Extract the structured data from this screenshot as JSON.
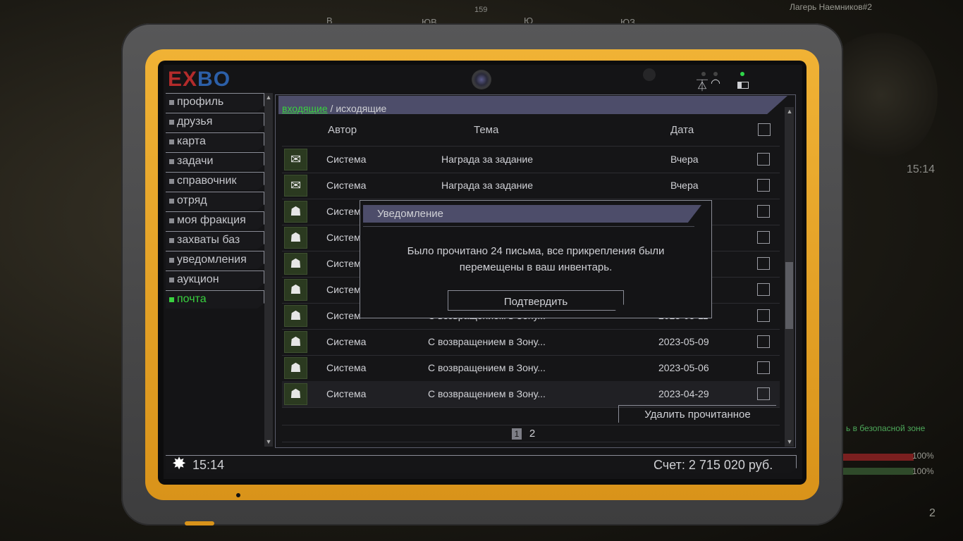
{
  "hud": {
    "compass": [
      "В",
      "ЮВ",
      "159",
      "Ю",
      "ЮЗ"
    ],
    "location": "Лагерь Наемников#2",
    "time": "15:14",
    "safe_zone_text": "ь в безопасной зоне",
    "health_pct": "100%",
    "stamina_pct": "100%",
    "ammo": "2"
  },
  "tablet": {
    "logo": {
      "part1": "EX",
      "part2": "BO"
    },
    "led_color": "#2fd64a"
  },
  "menu": {
    "items": [
      {
        "label": "профиль"
      },
      {
        "label": "друзья"
      },
      {
        "label": "карта"
      },
      {
        "label": "задачи"
      },
      {
        "label": "справочник"
      },
      {
        "label": "отряд"
      },
      {
        "label": "моя фракция"
      },
      {
        "label": "захваты баз"
      },
      {
        "label": "уведомления"
      },
      {
        "label": "аукцион"
      },
      {
        "label": "почта",
        "active": true
      }
    ]
  },
  "mail": {
    "tab_inbox": "входящие",
    "tab_separator": "/",
    "tab_outbox": "исходящие",
    "columns": {
      "author": "Автор",
      "subject": "Тема",
      "date": "Дата"
    },
    "rows": [
      {
        "icon": "envelope-icon",
        "author": "Система",
        "subject": "Награда за задание",
        "date": "Вчера"
      },
      {
        "icon": "envelope-icon",
        "author": "Система",
        "subject": "Награда за задание",
        "date": "Вчера"
      },
      {
        "icon": "stalker-icon",
        "author": "Систем",
        "subject": "",
        "date": ""
      },
      {
        "icon": "stalker-icon",
        "author": "Систем",
        "subject": "",
        "date": ""
      },
      {
        "icon": "stalker-icon",
        "author": "Систем",
        "subject": "",
        "date": ""
      },
      {
        "icon": "stalker-icon",
        "author": "Систем",
        "subject": "",
        "date": ""
      },
      {
        "icon": "stalker-icon",
        "author": "Систем",
        "subject": "С возвращением в Зону...",
        "date": "2023-05-11"
      },
      {
        "icon": "stalker-icon",
        "author": "Система",
        "subject": "С возвращением в Зону...",
        "date": "2023-05-09"
      },
      {
        "icon": "stalker-icon",
        "author": "Система",
        "subject": "С возвращением в Зону...",
        "date": "2023-05-06"
      },
      {
        "icon": "stalker-icon",
        "author": "Система",
        "subject": "С возвращением в Зону...",
        "date": "2023-04-29"
      }
    ],
    "delete_read_label": "Удалить прочитанное",
    "pages": [
      "1",
      "2"
    ],
    "current_page": "1"
  },
  "footer": {
    "time": "15:14",
    "balance": "Счет: 2 715 020 руб."
  },
  "modal": {
    "title": "Уведомление",
    "message": "Было прочитано 24 письма, все прикрепления были перемещены в ваш инвентарь.",
    "confirm_label": "Подтвердить"
  }
}
